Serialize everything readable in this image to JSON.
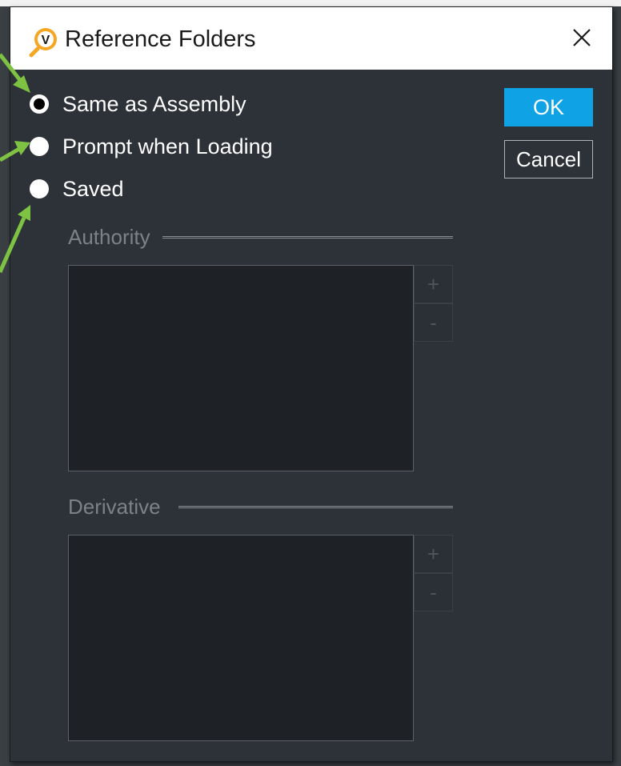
{
  "window": {
    "title": "Reference Folders",
    "close_icon": "close-icon",
    "logo_letter": "V"
  },
  "options": [
    {
      "label": "Same as Assembly",
      "checked": true
    },
    {
      "label": "Prompt when Loading",
      "checked": false
    },
    {
      "label": "Saved",
      "checked": false
    }
  ],
  "buttons": {
    "ok": "OK",
    "cancel": "Cancel"
  },
  "authority": {
    "label": "Authority",
    "add": "+",
    "remove": "-"
  },
  "derivative": {
    "label": "Derivative",
    "add": "+",
    "remove": "-"
  },
  "colors": {
    "accent": "#0fa3e6",
    "arrow": "#7dc242",
    "logo": "#f5a623"
  }
}
